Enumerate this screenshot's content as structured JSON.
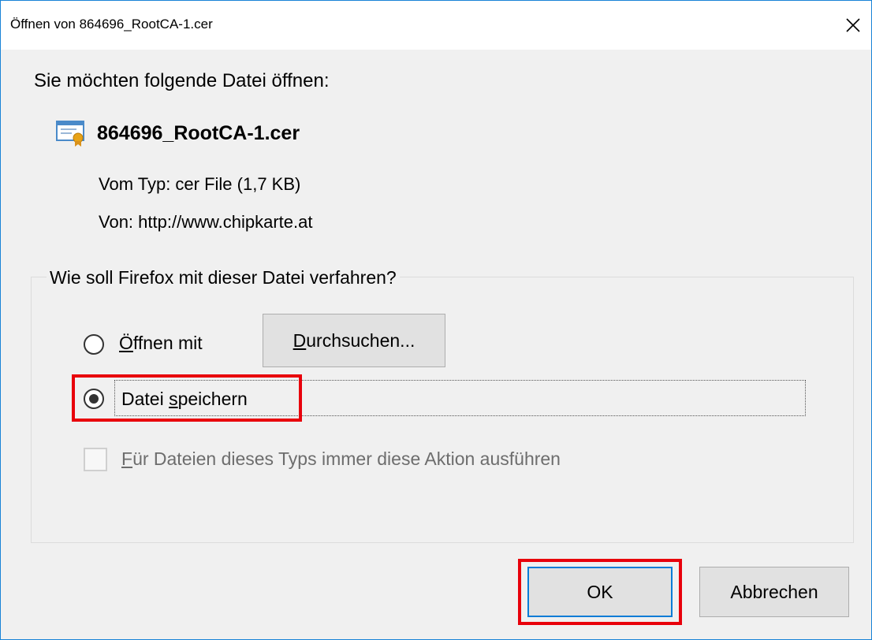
{
  "window": {
    "title": "Öffnen von 864696_RootCA-1.cer"
  },
  "prompt": "Sie möchten folgende Datei öffnen:",
  "file": {
    "name": "864696_RootCA-1.cer",
    "icon": "certificate-icon",
    "type_line": "Vom Typ: cer File (1,7 KB)",
    "from_line": "Von: http://www.chipkarte.at"
  },
  "action_group": {
    "legend": "Wie soll Firefox mit dieser Datei verfahren?",
    "open_with": {
      "label_first": "Ö",
      "label_rest": "ffnen mit",
      "selected": false
    },
    "browse_button": {
      "label_first": "D",
      "label_rest": "urchsuchen..."
    },
    "save_file": {
      "label_pre": "Datei ",
      "label_underlined": "s",
      "label_post": "peichern",
      "selected": true
    },
    "always_checkbox": {
      "label_first": "F",
      "label_rest": "ür Dateien dieses Typs immer diese Aktion ausführen",
      "checked": false,
      "enabled": false
    }
  },
  "buttons": {
    "ok": "OK",
    "cancel": "Abbrechen"
  },
  "colors": {
    "highlight": "#e8000b",
    "focus_border": "#0a7cd6",
    "window_border": "#1883d7"
  }
}
